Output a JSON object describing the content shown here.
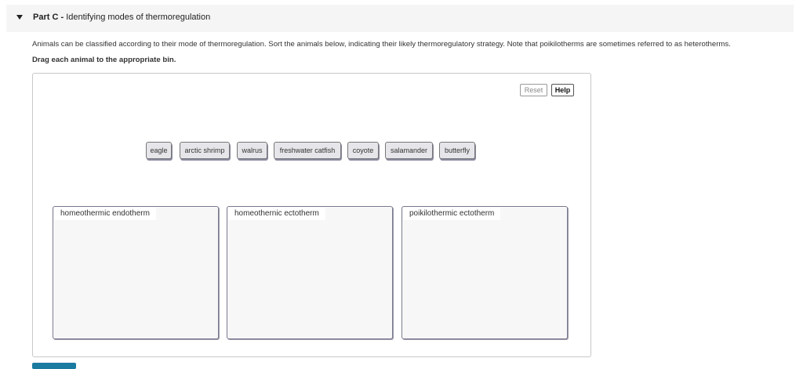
{
  "part": {
    "label": "Part C -",
    "title": "Identifying modes of thermoregulation"
  },
  "instructions": "Animals can be classified according to their mode of thermoregulation. Sort the animals below, indicating their likely thermoregulatory strategy. Note that poikilotherms are sometimes referred to as heterotherms.",
  "drag_instruction": "Drag each animal to the appropriate bin.",
  "buttons": {
    "reset": "Reset",
    "help": "Help"
  },
  "animals": [
    "eagle",
    "arctic shrimp",
    "walrus",
    "freshwater catfish",
    "coyote",
    "salamander",
    "butterfly"
  ],
  "bins": [
    "homeothermic endotherm",
    "homeothernic ectotherm",
    "poikilothermic ectotherm"
  ]
}
